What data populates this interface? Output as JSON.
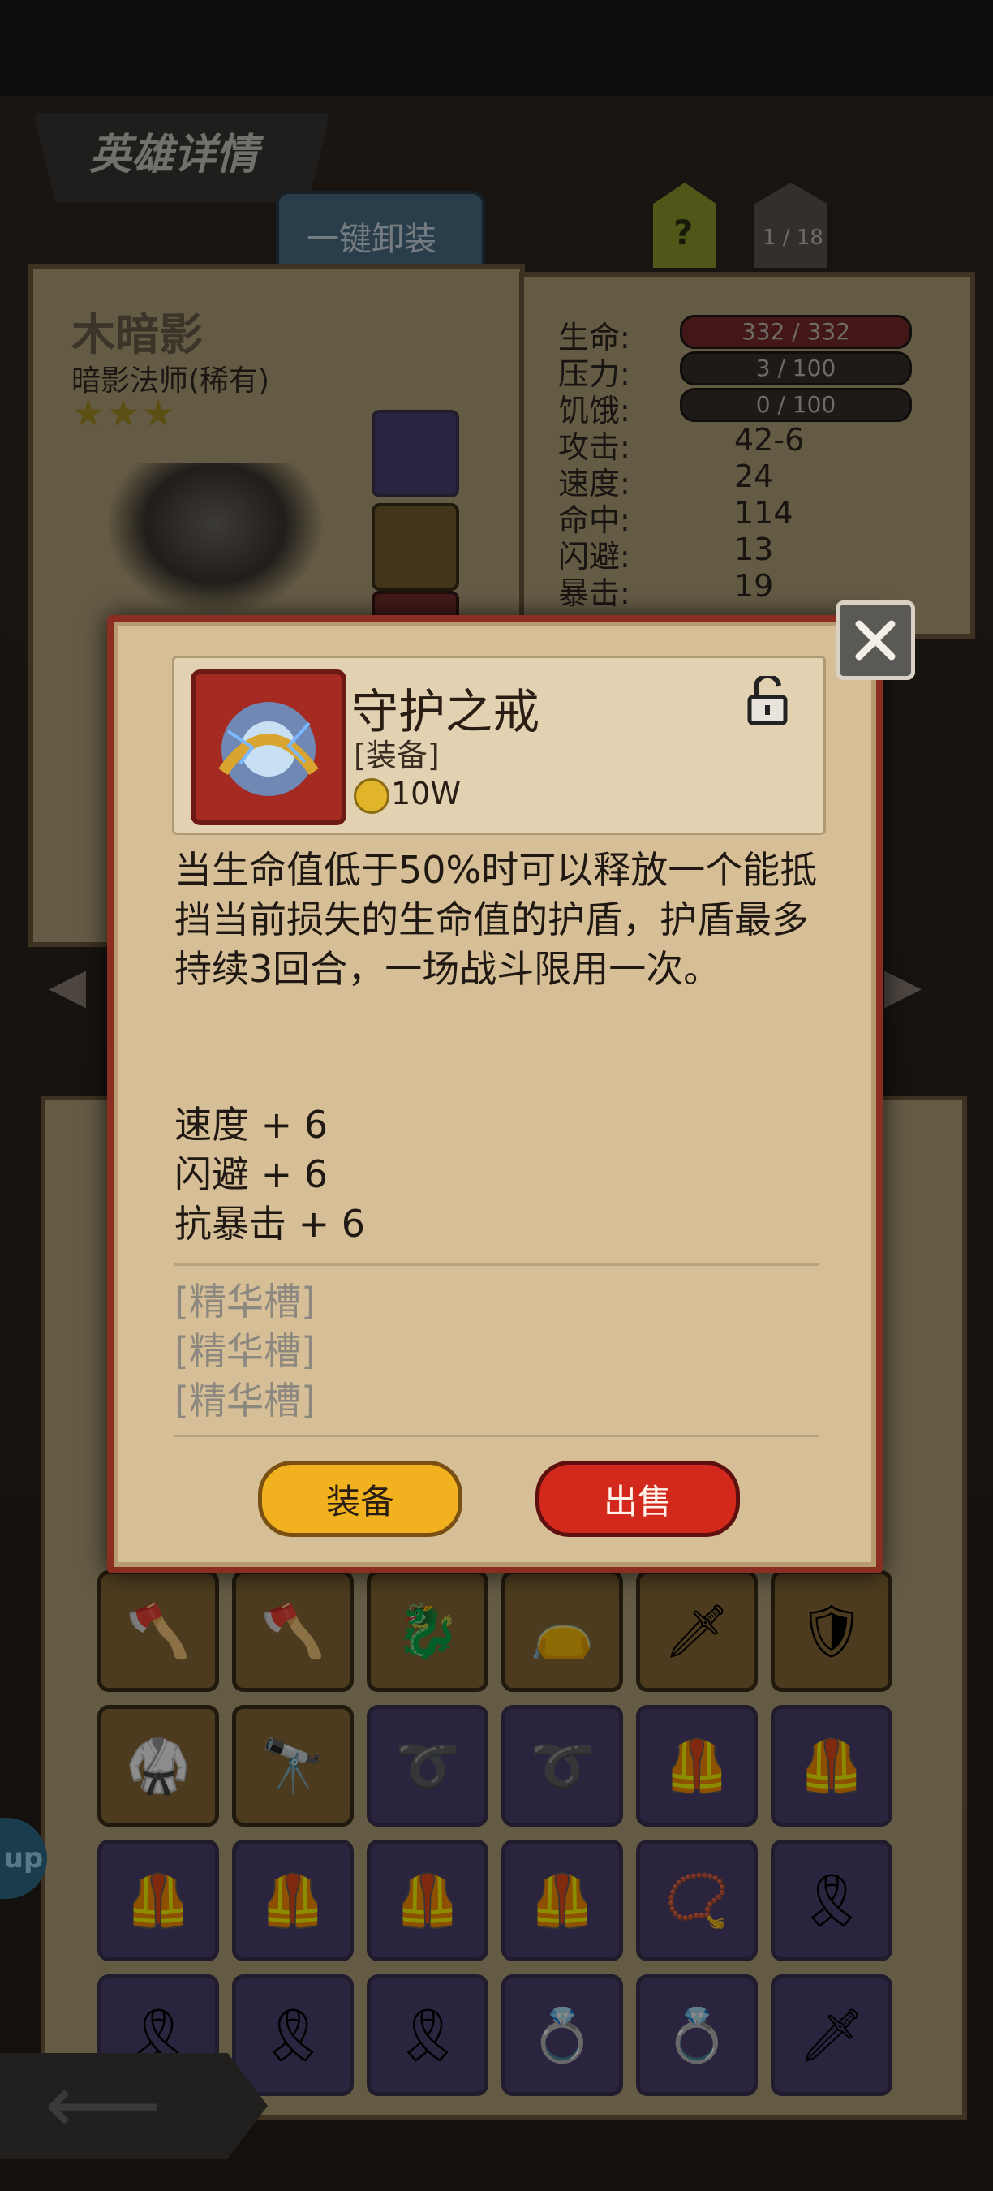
{
  "header": {
    "title": "英雄详情",
    "unequip_all": "一键卸装",
    "help": "?",
    "page": "1 / 18"
  },
  "hero": {
    "name": "木暗影",
    "class": "暗影法师(稀有)",
    "stars": "★★★"
  },
  "stats": [
    {
      "label": "生命:",
      "value": "332 / 332",
      "bar": "red"
    },
    {
      "label": "压力:",
      "value": "3 / 100",
      "bar": "dark"
    },
    {
      "label": "饥饿:",
      "value": "0 / 100",
      "bar": "dark"
    },
    {
      "label": "攻击:",
      "value": "42-6"
    },
    {
      "label": "速度:",
      "value": "24"
    },
    {
      "label": "命中:",
      "value": "114"
    },
    {
      "label": "闪避:",
      "value": "13"
    },
    {
      "label": "暴击:",
      "value": "19"
    }
  ],
  "popup": {
    "item_name": "守护之戒",
    "item_type": "[装备]",
    "price": "10W",
    "description": "当生命值低于50%时可以释放一个能抵挡当前损失的生命值的护盾，护盾最多持续3回合，一场战斗限用一次。",
    "bonuses": [
      "速度 + 6",
      "闪避 + 6",
      "抗暴击 + 6"
    ],
    "essence_slots": [
      "[精华槽]",
      "[精华槽]",
      "[精华槽]"
    ],
    "equip_label": "装备",
    "sell_label": "出售"
  },
  "side_badge": "up",
  "colors": {
    "popup_border": "#8a2e22",
    "equip": "#f2b21f",
    "sell": "#d3281c"
  }
}
